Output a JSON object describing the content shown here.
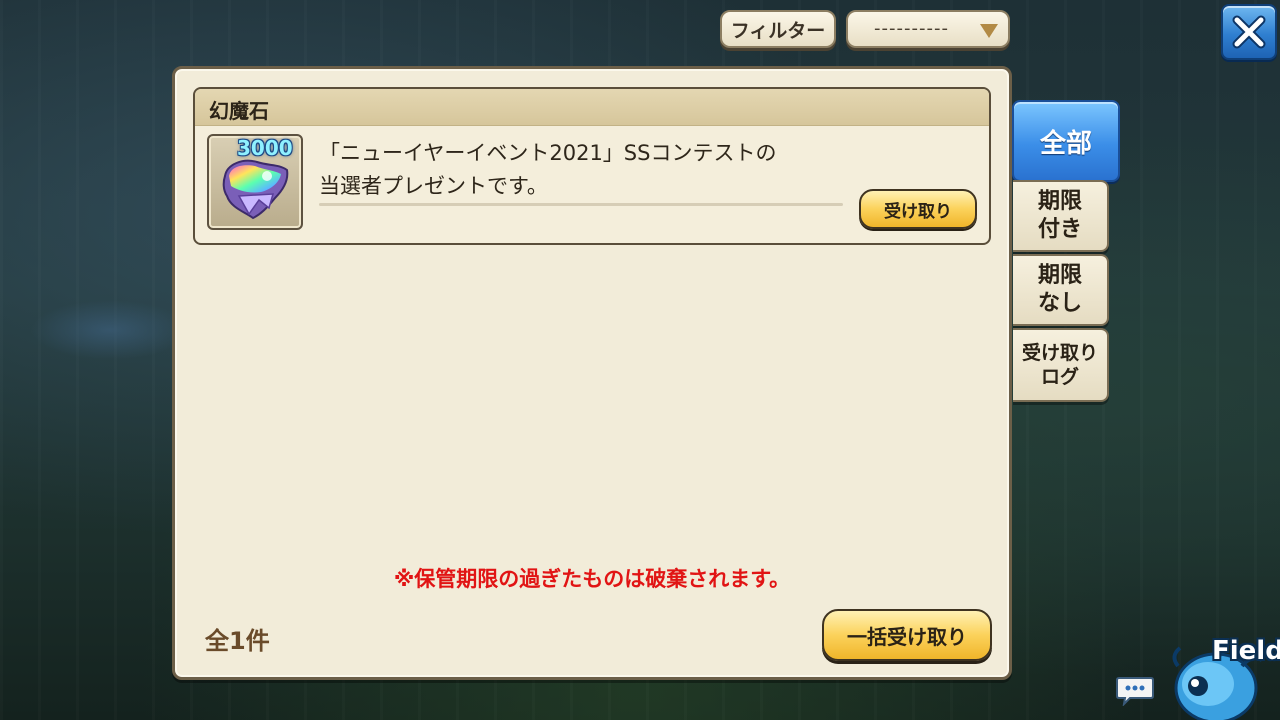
{
  "filter": {
    "button_label": "フィルター",
    "select_value": "----------"
  },
  "panel": {
    "item": {
      "category": "幻魔石",
      "quantity": "3000",
      "description_line1": "「ニューイヤーイベント2021」SSコンテストの",
      "description_line2": "当選者プレゼントです。",
      "claim_label": "受け取り"
    },
    "notice": "※保管期限の過ぎたものは破棄されます。",
    "total": "全1件",
    "bulk_claim_label": "一括受け取り"
  },
  "tabs": [
    {
      "label": "全部",
      "active": true
    },
    {
      "label": "期限\n付き",
      "active": false
    },
    {
      "label": "期限\nなし",
      "active": false
    },
    {
      "label": "受け取り\nログ",
      "active": false
    }
  ],
  "corner": {
    "field_label": "Field"
  },
  "colors": {
    "panel_bg": "#f2ecd9",
    "accent_blue": "#3b8ee8",
    "button_gold": "#fbd25b",
    "notice_red": "#e11414"
  }
}
